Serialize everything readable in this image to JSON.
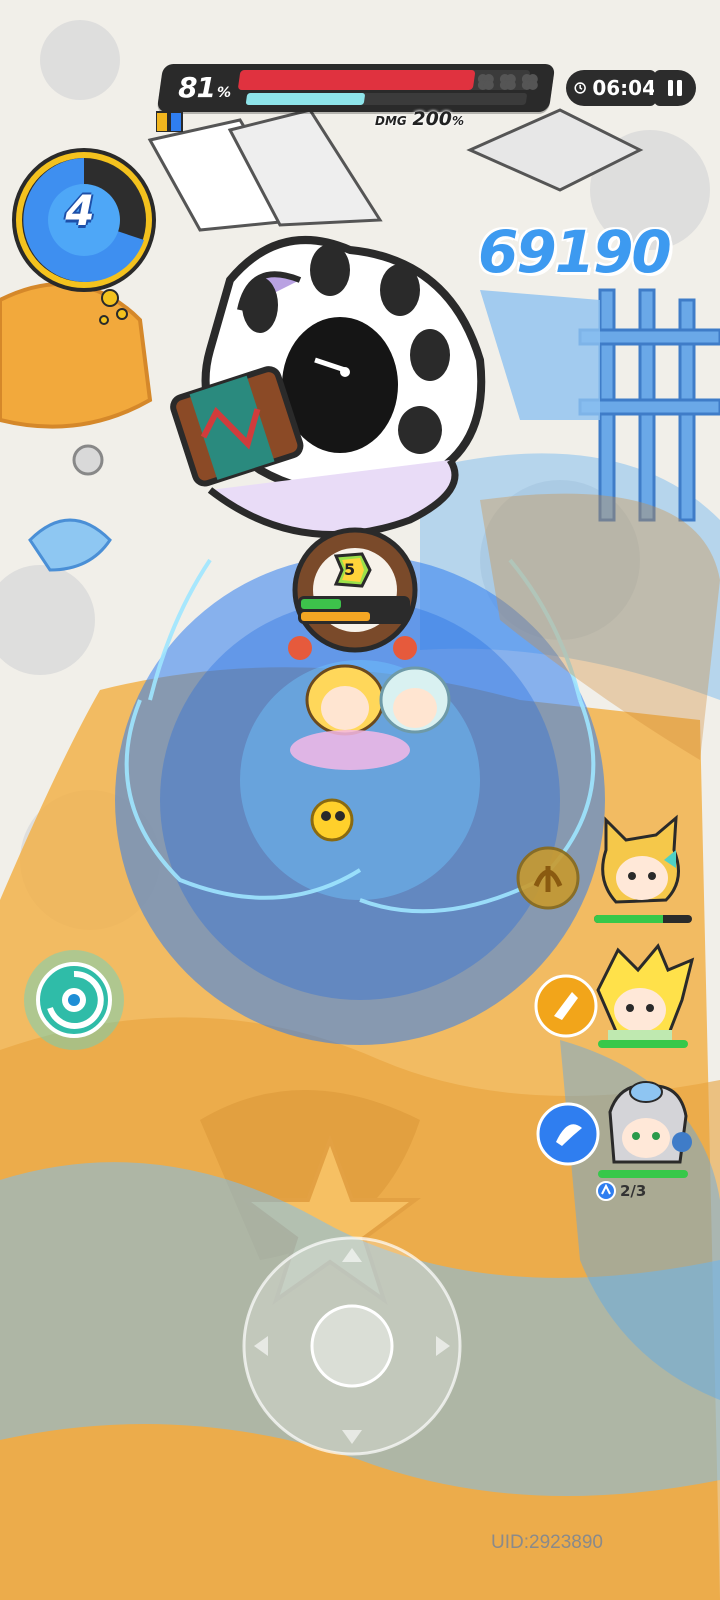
{
  "boss": {
    "hp_percent": "81",
    "hp_percent_symbol": "%",
    "hp_fraction": 0.81,
    "shield_fraction": 0.42,
    "dmg_label": "DMG",
    "dmg_value": "200",
    "dmg_symbol": "%"
  },
  "timer": {
    "time": "06:04"
  },
  "wave": {
    "current": "4"
  },
  "score": "69190",
  "player": {
    "level": "5",
    "hp_fraction": 0.38,
    "ex_fraction": 0.65
  },
  "party": {
    "members": [
      {
        "name": "blonde-cat-ear",
        "hp_fraction": 0.7
      },
      {
        "name": "spiky-blonde",
        "hp_fraction": 1.0
      },
      {
        "name": "silver-hair",
        "hp_fraction": 1.0
      }
    ],
    "charges": "2/3"
  },
  "uid": "UID:2923890",
  "colors": {
    "boss_hp": "#e0323f",
    "boss_shield": "#8ee4ea",
    "score": "#3d9af0",
    "hp_green": "#3dc24b",
    "ex_orange": "#f5a623",
    "aura_blue": "#2f7ef0"
  }
}
